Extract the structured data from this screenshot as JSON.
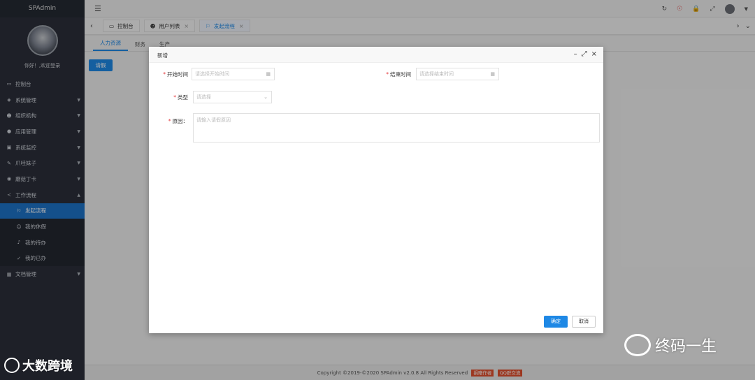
{
  "app": {
    "brand": "SPAdmin",
    "welcome": "你好！,欢迎登录"
  },
  "sidebar": {
    "items": [
      {
        "label": "控制台",
        "icon": "monitor-icon",
        "glyph": "▭"
      },
      {
        "label": "系统管理",
        "icon": "layers-icon",
        "glyph": "◈",
        "arrow": "▼"
      },
      {
        "label": "组织机构",
        "icon": "users-icon",
        "glyph": "☻",
        "arrow": "▼"
      },
      {
        "label": "应用管理",
        "icon": "app-icon",
        "glyph": "●",
        "arrow": "▼"
      },
      {
        "label": "系统监控",
        "icon": "monitor-chart-icon",
        "glyph": "▣",
        "arrow": "▼"
      },
      {
        "label": "爪哇妹子",
        "icon": "pen-icon",
        "glyph": "✎",
        "arrow": "▼"
      },
      {
        "label": "蘑菇丁卡",
        "icon": "pin-icon",
        "glyph": "◉",
        "arrow": "▼"
      },
      {
        "label": "工作流程",
        "icon": "share-icon",
        "glyph": "≺",
        "arrow": "▲"
      },
      {
        "label": "发起流程",
        "icon": "flag-icon",
        "glyph": "⚐",
        "sub": true,
        "active": true
      },
      {
        "label": "我的休假",
        "icon": "smile-icon",
        "glyph": "☺",
        "sub": true
      },
      {
        "label": "我的待办",
        "icon": "bell-icon",
        "glyph": "♪",
        "sub": true
      },
      {
        "label": "我的已办",
        "icon": "check-icon",
        "glyph": "✓",
        "sub": true
      },
      {
        "label": "文档管理",
        "icon": "calendar-icon",
        "glyph": "▦",
        "arrow": "▼"
      }
    ]
  },
  "header": {
    "toggle": "☰",
    "icons": [
      "↻",
      "☉",
      "🔒",
      "⤢"
    ],
    "user_arrow": "▼"
  },
  "tabs": {
    "prev": "‹",
    "next": "›",
    "more": "⌄",
    "items": [
      {
        "label": "控制台",
        "glyph": "▭",
        "closable": false
      },
      {
        "label": "用户列表",
        "glyph": "☻",
        "closable": true
      },
      {
        "label": "发起流程",
        "glyph": "⚐",
        "closable": true,
        "current": true
      }
    ],
    "close_glyph": "×"
  },
  "content": {
    "subtabs": [
      "人力资源",
      "财务",
      "生产"
    ],
    "apply_button": "请假"
  },
  "modal": {
    "title": "新增",
    "start_label": "开始时间",
    "start_placeholder": "请选择开始时间",
    "end_label": "结束时间",
    "end_placeholder": "请选择结束时间",
    "type_label": "类型",
    "type_placeholder": "请选择",
    "reason_label": "原因：",
    "reason_placeholder": "请输入请假原因",
    "ok": "确定",
    "cancel": "取消"
  },
  "footer": {
    "text": "Copyright ©2019-©2020 SPAdmin v2.0.8 All Rights Reserved",
    "badge1": "捐赠作者",
    "badge2": "QQ群交流"
  },
  "watermarks": {
    "left": "大数跨境",
    "right": "终码一生"
  }
}
